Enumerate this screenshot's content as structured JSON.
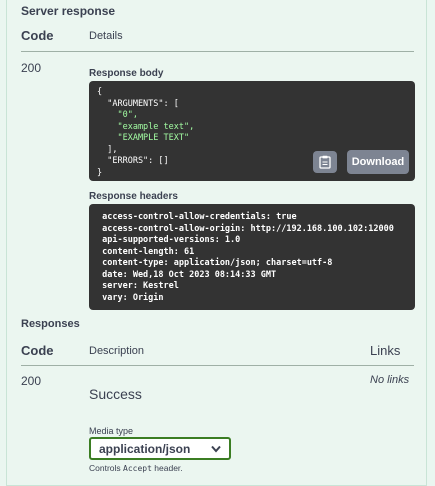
{
  "server_response": {
    "title": "Server response",
    "col_code": "Code",
    "col_details": "Details",
    "code": "200",
    "response_body_label": "Response body",
    "response_body_lines": [
      {
        "text": "{",
        "type": "plain"
      },
      {
        "text": "  \"ARGUMENTS\": [",
        "type": "plain"
      },
      {
        "text": "    \"0\",",
        "type": "str"
      },
      {
        "text": "    \"example text\",",
        "type": "str"
      },
      {
        "text": "    \"EXAMPLE TEXT\"",
        "type": "str"
      },
      {
        "text": "  ],",
        "type": "plain"
      },
      {
        "text": "  \"ERRORS\": []",
        "type": "plain"
      },
      {
        "text": "}",
        "type": "plain"
      }
    ],
    "download_label": "Download",
    "copy_icon": "clipboard-icon",
    "response_headers_label": "Response headers",
    "response_headers": [
      " access-control-allow-credentials: true",
      " access-control-allow-origin: http://192.168.100.102:12000",
      " api-supported-versions: 1.0",
      " content-length: 61",
      " content-type: application/json; charset=utf-8",
      " date: Wed,18 Oct 2023 08:14:33 GMT",
      " server: Kestrel",
      " vary: Origin"
    ]
  },
  "responses": {
    "title": "Responses",
    "col_code": "Code",
    "col_description": "Description",
    "col_links": "Links",
    "code": "200",
    "description": "Success",
    "links": "No links",
    "media_type_label": "Media type",
    "media_type_value": "application/json",
    "controls_prefix": "Controls ",
    "controls_code": "Accept",
    "controls_suffix": " header."
  },
  "colors": {
    "panel_bg": "#ebf6f0",
    "code_bg": "#333333",
    "string_green": "#a2fca2",
    "button_gray": "#7d8492",
    "select_border": "#3b7d23"
  }
}
